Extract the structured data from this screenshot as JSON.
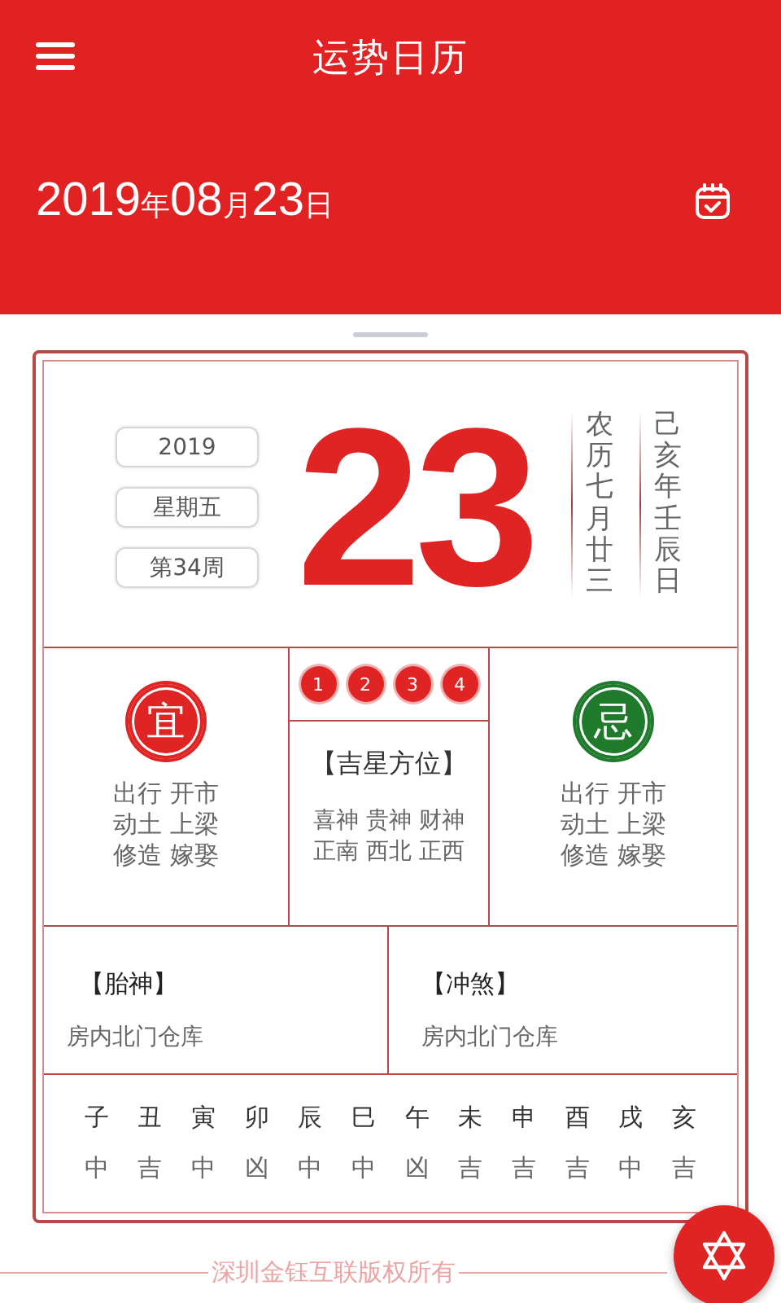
{
  "header": {
    "title": "运势日历",
    "date": {
      "year": "2019",
      "year_unit": "年",
      "month": "08",
      "month_unit": "月",
      "day": "23",
      "day_unit": "日"
    }
  },
  "summary": {
    "badges": [
      "2019",
      "星期五",
      "第34周"
    ],
    "day": "23",
    "lunar": "农历七月廿三",
    "ganzhi": "己亥年壬辰日"
  },
  "advice": [
    {
      "seal": "宜",
      "color": "#e02424",
      "items": [
        "出行 开市",
        "动土 上梁",
        "修造 嫁娶"
      ]
    },
    {
      "seal": "忌",
      "color": "#1f7a2c",
      "items": [
        "出行 开市",
        "动土 上梁",
        "修造 嫁娶"
      ]
    }
  ],
  "stars": {
    "tabs": [
      "1",
      "2",
      "3",
      "4"
    ],
    "title": "【吉星方位】",
    "lines": [
      "喜神 贵神 财神",
      "正南 西北 正西"
    ]
  },
  "sections": [
    {
      "title": "【胎神】",
      "text": "房内北门仓库"
    },
    {
      "title": "【冲煞】",
      "text": "房内北门仓库"
    }
  ],
  "hours": [
    {
      "branch": "子",
      "luck": "中"
    },
    {
      "branch": "丑",
      "luck": "吉"
    },
    {
      "branch": "寅",
      "luck": "中"
    },
    {
      "branch": "卯",
      "luck": "凶"
    },
    {
      "branch": "辰",
      "luck": "中"
    },
    {
      "branch": "巳",
      "luck": "中"
    },
    {
      "branch": "午",
      "luck": "凶"
    },
    {
      "branch": "未",
      "luck": "吉"
    },
    {
      "branch": "申",
      "luck": "吉"
    },
    {
      "branch": "酉",
      "luck": "吉"
    },
    {
      "branch": "戌",
      "luck": "中"
    },
    {
      "branch": "亥",
      "luck": "吉"
    }
  ],
  "footer": "深圳金钰互联版权所有"
}
